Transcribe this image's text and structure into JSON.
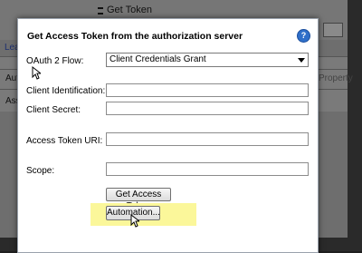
{
  "background": {
    "top_text": "Get Token",
    "link_fragment": "Lea",
    "row1_label": "Aut",
    "row2_label": "Ass",
    "column_header": "Property"
  },
  "dialog": {
    "title": "Get Access Token from the authorization server",
    "help_icon_glyph": "?",
    "oauth_flow": {
      "label": "OAuth 2 Flow:",
      "selected": "Client Credentials Grant"
    },
    "client_id": {
      "label": "Client Identification:",
      "value": ""
    },
    "client_secret": {
      "label": "Client Secret:",
      "value": ""
    },
    "access_token_uri": {
      "label": "Access Token URI:",
      "value": ""
    },
    "scope": {
      "label": "Scope:",
      "value": ""
    },
    "get_token_button": "Get Access Token",
    "automation_button": "Automation..."
  },
  "colors": {
    "highlight": "#fbf79a",
    "help": "#2f6fc9"
  }
}
